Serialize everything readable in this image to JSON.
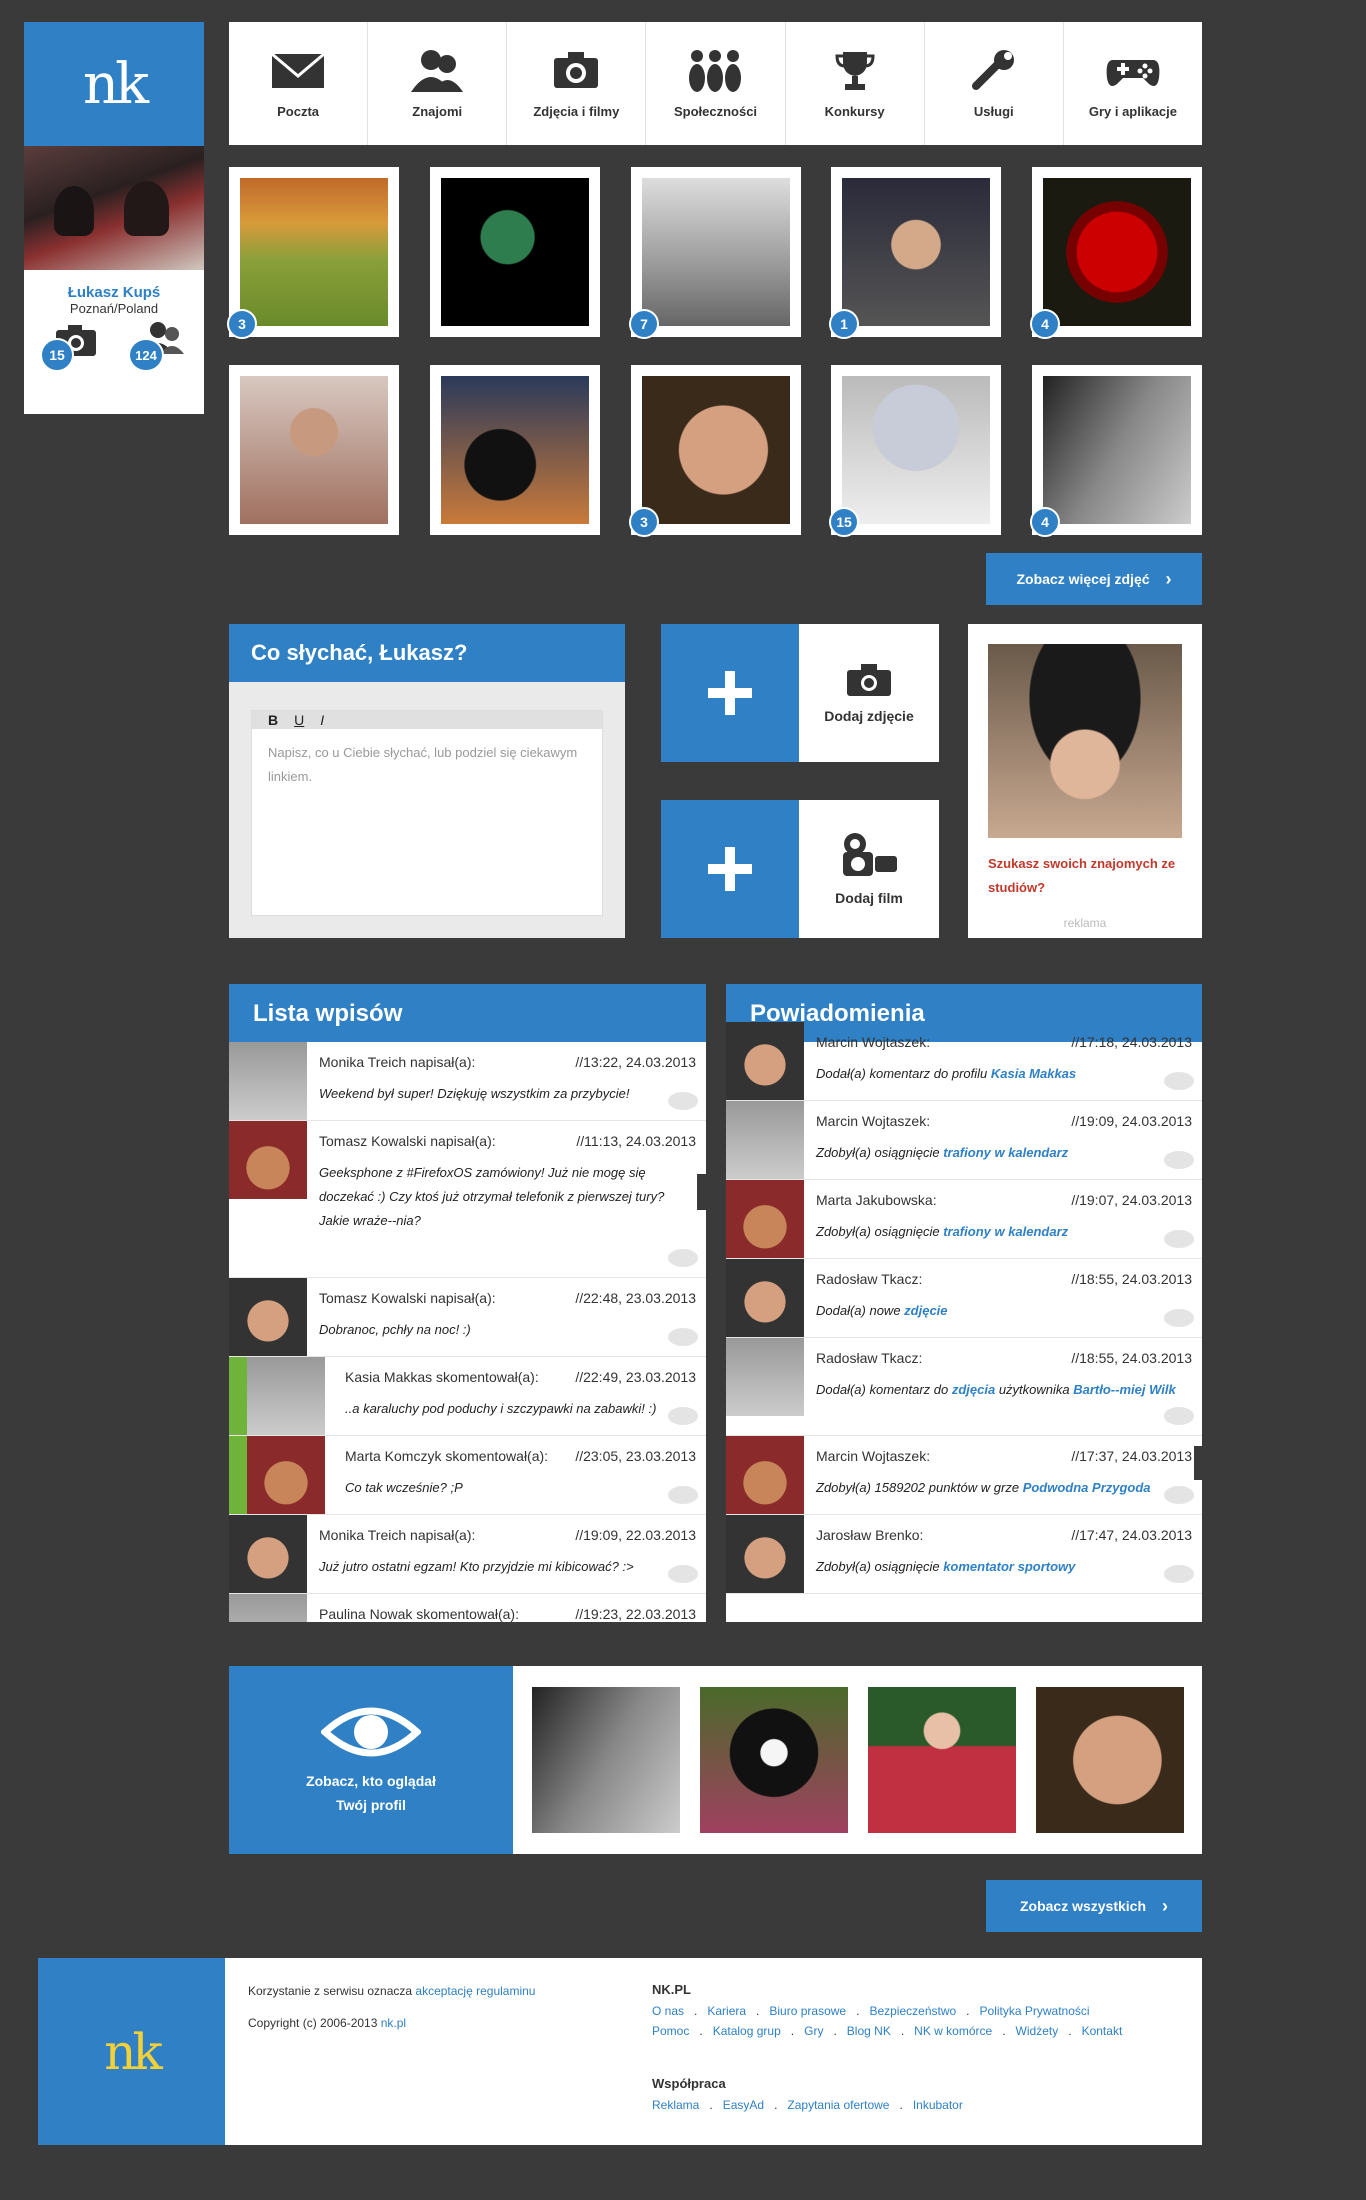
{
  "profile": {
    "name": "Łukasz Kupś",
    "location": "Poznań/Poland",
    "photos_count": "15",
    "friends_count": "124",
    "logo": "nk"
  },
  "nav": [
    {
      "label": "Poczta",
      "icon": "mail-icon"
    },
    {
      "label": "Znajomi",
      "icon": "friends-icon"
    },
    {
      "label": "Zdjęcia i filmy",
      "icon": "camera-icon"
    },
    {
      "label": "Społeczności",
      "icon": "community-icon"
    },
    {
      "label": "Konkursy",
      "icon": "trophy-icon"
    },
    {
      "label": "Usługi",
      "icon": "wrench-icon"
    },
    {
      "label": "Gry i aplikacje",
      "icon": "gamepad-icon"
    }
  ],
  "gallery": {
    "row1": [
      "3",
      "",
      "7",
      "1",
      "4"
    ],
    "row2": [
      "",
      "",
      "3",
      "15",
      "4"
    ],
    "more_button": "Zobacz więcej zdjęć"
  },
  "status": {
    "title": "Co słychać, Łukasz?",
    "tools": [
      "B",
      "U",
      "I"
    ],
    "placeholder": "Napisz, co u Ciebie słychać, lub podziel się ciekawym linkiem."
  },
  "add_photo": "Dodaj zdjęcie",
  "add_video": "Dodaj film",
  "ad": {
    "text": "Szukasz swoich znajomych ze studiów?",
    "label": "reklama"
  },
  "entries": {
    "title": "Lista wpisów",
    "items": [
      {
        "who": "Monika Treich napisał(a):",
        "when": "//13:22, 24.03.2013",
        "msg": "Weekend był super! Dziękuję wszystkim za przybycie!"
      },
      {
        "who": "Tomasz Kowalski napisał(a):",
        "when": "//11:13, 24.03.2013",
        "msg": "Geeksphone z #FirefoxOS zamówiony! Już nie mogę się doczekać :) Czy ktoś już otrzymał telefonik z pierwszej tury? Jakie wraże--nia?"
      },
      {
        "who": "Tomasz Kowalski napisał(a):",
        "when": "//22:48, 23.03.2013",
        "msg": "Dobranoc, pchły na noc! :)"
      },
      {
        "who": "Kasia Makkas skomentował(a):",
        "when": "//22:49, 23.03.2013",
        "msg": "..a karaluchy pod poduchy i szczypawki na zabawki! :)"
      },
      {
        "who": "Marta Komczyk skomentował(a):",
        "when": "//23:05, 23.03.2013",
        "msg": "Co tak wcześnie? ;P"
      },
      {
        "who": "Monika Treich napisał(a):",
        "when": "//19:09, 22.03.2013",
        "msg": "Już jutro ostatni egzam! Kto przyjdzie mi kibicować? :>"
      },
      {
        "who": "Paulina Nowak skomentował(a):",
        "when": "//19:23, 22.03.2013",
        "msg": ""
      }
    ]
  },
  "notifications": {
    "title": "Powiadomienia",
    "items": [
      {
        "who": "Marcin Wojtaszek:",
        "when": "//17:18, 24.03.2013",
        "pre": "Dodał(a) komentarz do profilu ",
        "link": "Kasia Makkas",
        "post": ""
      },
      {
        "who": "Marcin Wojtaszek:",
        "when": "//19:09, 24.03.2013",
        "pre": "Zdobył(a) osiągnięcie ",
        "link": "trafiony w kalendarz",
        "post": ""
      },
      {
        "who": "Marta Jakubowska:",
        "when": "//19:07, 24.03.2013",
        "pre": "Zdobył(a) osiągnięcie ",
        "link": "trafiony w kalendarz",
        "post": ""
      },
      {
        "who": "Radosław Tkacz:",
        "when": "//18:55, 24.03.2013",
        "pre": "Dodał(a) nowe ",
        "link": "zdjęcie",
        "post": ""
      },
      {
        "who": "Radosław Tkacz:",
        "when": "//18:55, 24.03.2013",
        "pre": "Dodał(a) komentarz do ",
        "link": "zdjęcia",
        "post": " użytkownika ",
        "link2": "Bartło--miej Wilk"
      },
      {
        "who": "Marcin Wojtaszek:",
        "when": "//17:37, 24.03.2013",
        "pre": "Zdobył(a) 1589202 punktów w grze ",
        "link": "Podwodna Przygoda",
        "post": ""
      },
      {
        "who": "Jarosław Brenko:",
        "when": "//17:47, 24.03.2013",
        "pre": "Zdobył(a) osiągnięcie ",
        "link": "komentator sportowy",
        "post": ""
      }
    ]
  },
  "visitors": {
    "line1": "Zobacz, kto oglądał",
    "line2": "Twój profil",
    "button": "Zobacz wszystkich"
  },
  "footer": {
    "terms_pre": "Korzystanie z serwisu oznacza ",
    "terms_link": "akceptację regulaminu",
    "copyright_pre": "Copyright (c) 2006-2013 ",
    "copyright_link": "nk.pl",
    "section1": "NK.PL",
    "links1": [
      "O nas",
      "Kariera",
      "Biuro prasowe",
      "Bezpieczeństwo",
      "Polityka Prywatności"
    ],
    "links2": [
      "Pomoc",
      "Katalog grup",
      "Gry",
      "Blog NK",
      "NK w komórce",
      "Widżety",
      "Kontakt"
    ],
    "section2": "Współpraca",
    "links3": [
      "Reklama",
      "EasyAd",
      "Zapytania ofertowe",
      "Inkubator"
    ],
    "logo": "nk"
  },
  "colors": {
    "accent": "#2f80c4",
    "background": "#3a3a3a",
    "green": "#6fb33a",
    "ad_red": "#c0392b",
    "footer_logo": "#f4d038"
  }
}
